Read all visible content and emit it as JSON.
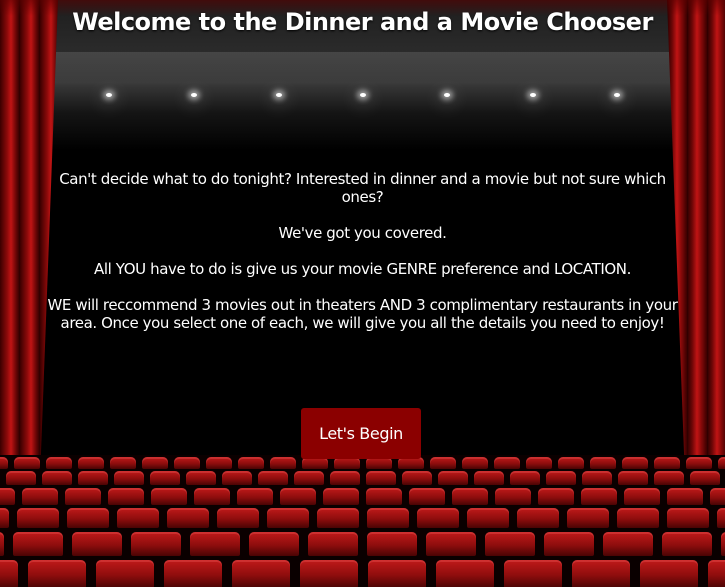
{
  "header": {
    "title": "Welcome to the Dinner and a Movie Chooser"
  },
  "intro": {
    "paragraphs": [
      "Can't decide what to do tonight? Interested in dinner and a movie but not sure which ones?",
      "We've got you covered.",
      "All YOU have to do is give us your movie GENRE preference and LOCATION.",
      "WE will reccommend 3 movies out in theaters AND 3 complimentary restaurants in your area. Once you select one of each, we will give you all the details you need to enjoy!"
    ]
  },
  "actions": {
    "begin_label": "Let's Begin"
  },
  "colors": {
    "button": "#8b0000",
    "curtain": "#b01010",
    "text": "#ffffff"
  }
}
